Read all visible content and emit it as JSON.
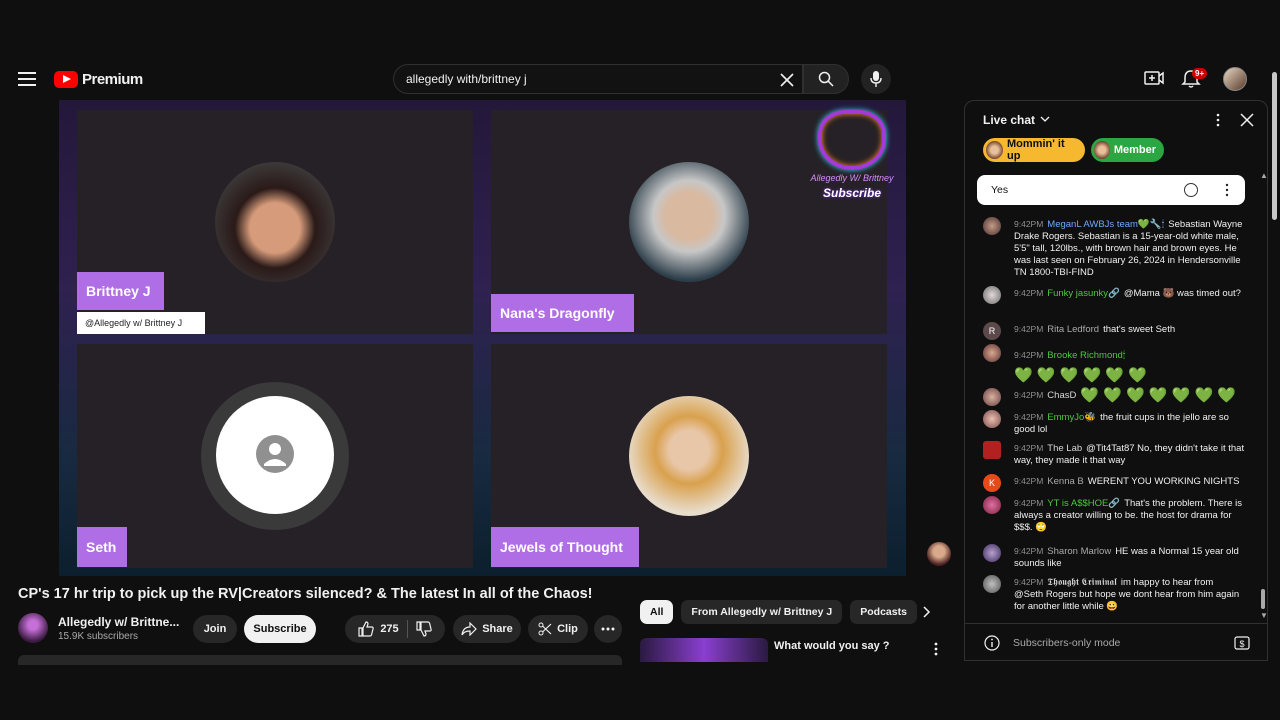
{
  "header": {
    "logo_text": "Premium",
    "search_value": "allegedly with/brittney j",
    "notification_count": "9+"
  },
  "video": {
    "participants": [
      {
        "name": "Brittney J",
        "handle": "@Allegedly w/ Brittney J"
      },
      {
        "name": "Nana's Dragonfly"
      },
      {
        "name": "Seth"
      },
      {
        "name": "Jewels of Thought"
      }
    ],
    "overlay_logo": {
      "line1": "Allegedly W/ Brittney",
      "line2": "Subscribe"
    }
  },
  "watch": {
    "title": "CP's 17 hr trip to pick up the RV|Creators silenced? & The latest In all of the Chaos!",
    "channel_name": "Allegedly w/ Brittne...",
    "subscribers": "15.9K subscribers",
    "join_label": "Join",
    "subscribe_label": "Subscribe",
    "like_count": "275",
    "share_label": "Share",
    "clip_label": "Clip"
  },
  "related": {
    "chips": [
      "All",
      "From Allegedly w/ Brittney J",
      "Podcasts"
    ],
    "first_video_title": "What would you say ?"
  },
  "chat": {
    "title": "Live chat",
    "tickers": [
      {
        "label": "Mommin' it up",
        "color": "#f5b82e"
      },
      {
        "label": "Member",
        "color": "#2ba640"
      }
    ],
    "pinned": "Yes",
    "messages": [
      {
        "time": "9:42PM",
        "author": "MeganL AWBJs team💚🔧🕯",
        "text": "Sebastian Wayne Drake Rogers. Sebastian is a 15-year-old white male, 5'5\" tall, 120lbs., with brown hair and brown eyes. He was last seen on February 26, 2024 in Hendersonville TN 1800-TBI-FIND"
      },
      {
        "time": "9:42PM",
        "author": "Funky jasunky🔗",
        "text": "@Mama 🐻 was timed out?"
      },
      {
        "time": "9:42PM",
        "author": "Rita Ledford",
        "text": "that's sweet Seth"
      },
      {
        "time": "9:42PM",
        "author": "Brooke Richmond🕯",
        "text": "💚 💚 💚 💚 💚 💚"
      },
      {
        "time": "9:42PM",
        "author": "ChasD",
        "text": "💚 💚 💚 💚 💚 💚 💚"
      },
      {
        "time": "9:42PM",
        "author": "EmmyJo🐝",
        "text": "the fruit cups in the jello are so good lol"
      },
      {
        "time": "9:42PM",
        "author": "The Lab",
        "text": "@Tit4Tat87 No, they didn't take it that way, they made it that way"
      },
      {
        "time": "9:42PM",
        "author": "Kenna B",
        "text": "WERENT YOU WORKING NIGHTS"
      },
      {
        "time": "9:42PM",
        "author": "YT is A$$HOE🔗",
        "text": "That's the problem. There is always a creator willing to be. the host for drama for $$$. 🙄"
      },
      {
        "time": "9:42PM",
        "author": "Sharon Marlow",
        "text": "HE was a Normal 15 year old sounds like"
      },
      {
        "time": "9:42PM",
        "author": "𝕿𝖍𝖔𝖚𝖌𝖍𝖙 𝕮𝖗𝖎𝖒𝖎𝖓𝖆𝖑",
        "text": "im happy to hear from @Seth Rogers but hope we dont hear from him again for another little while 😀"
      }
    ],
    "avatar_letters": {
      "rita": "R",
      "kenna": "K"
    },
    "footer": "Subscribers-only mode"
  }
}
